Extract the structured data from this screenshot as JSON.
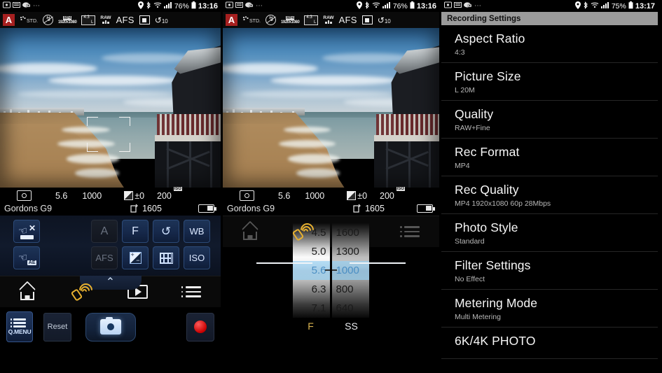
{
  "panel1": {
    "status_bar": {
      "left_icons": [
        "screenshot-icon",
        "sd-card-icon",
        "camera-cloud-icon",
        "more-dots-icon"
      ],
      "right_icons": [
        "location-icon",
        "bluetooth-icon",
        "wifi-icon",
        "signal-icon"
      ],
      "battery_percent": "76%",
      "time": "13:16"
    },
    "camera_bar": {
      "mode": "A",
      "photo_style": "STD.",
      "flash": "flash-off-icon",
      "rec_format": "MP4",
      "rec_quality_small": "1920x1080",
      "aspect": "4:3",
      "aspect_size": "L",
      "quality": "RAW",
      "focus_mode": "AFS",
      "metering": "single-area-af-icon",
      "self_timer": "10"
    },
    "info_bar": {
      "metering_icon": "metering-multi-icon",
      "aperture": "5.6",
      "shutter": "1000",
      "ev_label": "±0",
      "iso": "200",
      "iso_tag": "ISO",
      "device_name": "Gordons G9",
      "remaining_shots": "1605",
      "battery_icon": "battery-icon"
    },
    "quick_menu": {
      "touch_af_off": "touch-af-off-icon",
      "touch_ae": "touch-ae-icon",
      "buttons": [
        {
          "label": "A",
          "state": "dim"
        },
        {
          "label": "F",
          "state": "active"
        },
        {
          "label": "self-timer-icon",
          "state": "active"
        },
        {
          "label": "WB",
          "state": "active"
        },
        {
          "label": "AFS",
          "state": "dim"
        },
        {
          "label": "exposure-comp-icon",
          "state": "active"
        },
        {
          "label": "grid-icon",
          "state": "active"
        },
        {
          "label": "ISO",
          "state": "active"
        }
      ]
    },
    "lower": {
      "expand_chevron": "⌃",
      "qmenu_label": "Q.MENU",
      "reset_label": "Reset",
      "shutter_label": "camera-shutter-icon",
      "record_label": "record-icon"
    },
    "nav": {
      "items": [
        "home-icon",
        "wifi-connect-icon",
        "playback-icon",
        "menu-icon"
      ]
    }
  },
  "panel2": {
    "status_bar": {
      "battery_percent": "76%",
      "time": "13:16"
    },
    "camera_bar": {
      "mode": "A",
      "photo_style": "STD.",
      "rec_format": "MP4",
      "rec_quality_small": "1920x1080",
      "aspect": "4:3",
      "aspect_size": "L",
      "quality": "RAW",
      "focus_mode": "AFS",
      "self_timer": "10"
    },
    "info_bar": {
      "aperture": "5.6",
      "shutter": "1000",
      "ev_label": "±0",
      "iso": "200",
      "iso_tag": "ISO",
      "device_name": "Gordons G9",
      "remaining_shots": "1605"
    },
    "dial": {
      "f_label": "F",
      "ss_label": "SS",
      "f_values": [
        "4.5",
        "5.0",
        "5.6",
        "6.3",
        "7.1"
      ],
      "ss_values": [
        "1600",
        "1300",
        "1000",
        "800",
        "640"
      ],
      "selected_f": "5.6",
      "selected_ss": "1000",
      "selected_index": 2
    },
    "nav": {
      "items": [
        "home-icon",
        "wifi-connect-icon",
        "playback-icon",
        "menu-icon"
      ]
    }
  },
  "panel3": {
    "status_bar": {
      "battery_percent": "75%",
      "time": "13:17"
    },
    "title": "Recording Settings",
    "settings": [
      {
        "label": "Aspect Ratio",
        "value": "4:3"
      },
      {
        "label": "Picture Size",
        "value": "L 20M"
      },
      {
        "label": "Quality",
        "value": "RAW+Fine"
      },
      {
        "label": "Rec Format",
        "value": "MP4"
      },
      {
        "label": "Rec Quality",
        "value": "MP4 1920x1080 60p 28Mbps"
      },
      {
        "label": "Photo Style",
        "value": "Standard"
      },
      {
        "label": "Filter Settings",
        "value": "No Effect"
      },
      {
        "label": "Metering Mode",
        "value": "Multi Metering"
      },
      {
        "label": "6K/4K PHOTO",
        "value": ""
      }
    ]
  },
  "colors": {
    "accent_blue": "#4b8fc4",
    "mode_red": "#a62020",
    "wifi_yellow": "#e8b130",
    "record_red": "#c80000",
    "title_bar_gray": "#9b9b9b"
  }
}
